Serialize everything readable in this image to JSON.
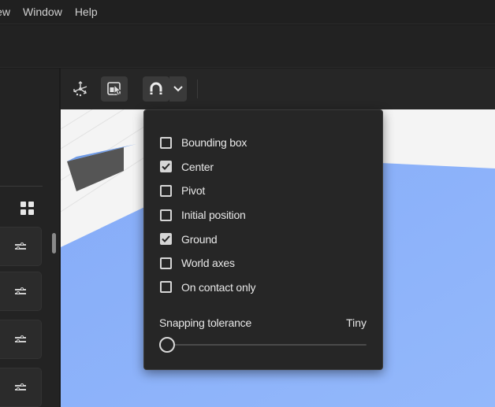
{
  "menubar": {
    "items": [
      {
        "label": "iew"
      },
      {
        "label": "Window"
      },
      {
        "label": "Help"
      }
    ]
  },
  "left_panel": {
    "grid_icon": "grid-icon",
    "rows": [
      {
        "icon": "sliders-icon"
      },
      {
        "icon": "sliders-icon"
      },
      {
        "icon": "sliders-icon"
      },
      {
        "icon": "sliders-icon"
      }
    ]
  },
  "viewport_toolbar": {
    "tools": [
      {
        "icon": "transform-gizmo-icon",
        "active": false
      },
      {
        "icon": "select-object-icon",
        "active": true
      },
      {
        "icon": "magnet-snap-icon",
        "active": true
      },
      {
        "icon": "chevron-down-icon",
        "active": true
      }
    ]
  },
  "snapping_popover": {
    "options": [
      {
        "label": "Bounding box",
        "checked": false
      },
      {
        "label": "Center",
        "checked": true
      },
      {
        "label": "Pivot",
        "checked": false
      },
      {
        "label": "Initial position",
        "checked": false
      },
      {
        "label": "Ground",
        "checked": true
      },
      {
        "label": "World axes",
        "checked": false
      },
      {
        "label": "On contact only",
        "checked": false
      }
    ],
    "tolerance_label": "Snapping tolerance",
    "tolerance_value": "Tiny",
    "tolerance_level": 0
  },
  "colors": {
    "ground": "#8fb4fb",
    "object_top": "#6e9ae6",
    "object_side": "#555555",
    "viewport_bg": "#f4f4f4"
  }
}
